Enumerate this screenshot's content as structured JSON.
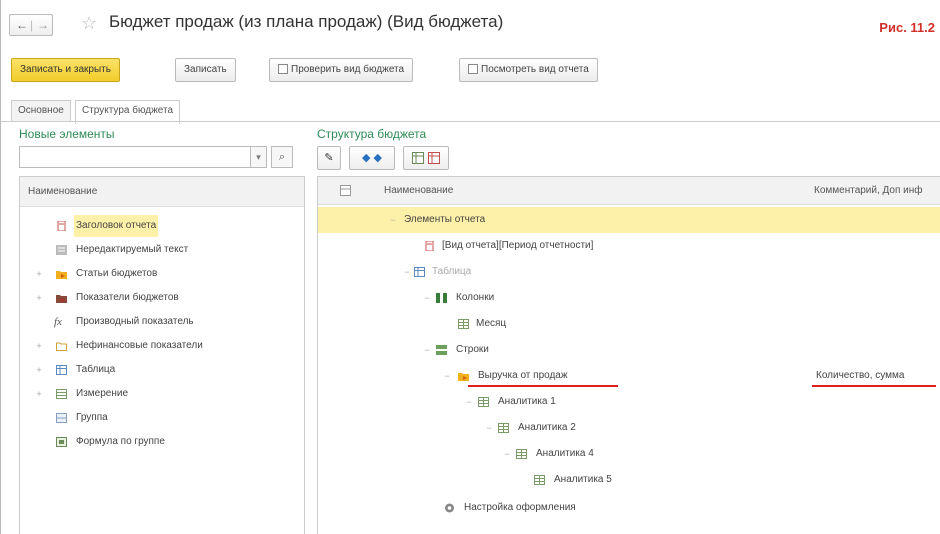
{
  "window": {
    "title": "Бюджет продаж (из плана продаж) (Вид бюджета)",
    "figure_label": "Рис. 11.2"
  },
  "toolbar": {
    "save_close": "Записать и закрыть",
    "save": "Записать",
    "check": "Проверить вид бюджета",
    "view_report": "Посмотреть вид отчета"
  },
  "tabs": [
    "Основное",
    "Структура бюджета"
  ],
  "left_panel": {
    "title": "Новые элементы",
    "search_placeholder": "",
    "column_header": "Наименование",
    "items": [
      {
        "label": "Заголовок отчета",
        "icon": "report-header-icon",
        "expandable": false,
        "selected": true
      },
      {
        "label": "Нередактируемый текст",
        "icon": "text-icon",
        "expandable": false,
        "selected": false
      },
      {
        "label": "Статьи бюджетов",
        "icon": "folder-icon",
        "expandable": true,
        "selected": false
      },
      {
        "label": "Показатели бюджетов",
        "icon": "indicator-icon",
        "expandable": true,
        "selected": false
      },
      {
        "label": "Производный показатель",
        "icon": "fx-icon",
        "expandable": false,
        "selected": false
      },
      {
        "label": "Нефинансовые показатели",
        "icon": "folder-outline-icon",
        "expandable": true,
        "selected": false
      },
      {
        "label": "Таблица",
        "icon": "table-icon",
        "expandable": true,
        "selected": false
      },
      {
        "label": "Измерение",
        "icon": "dimension-icon",
        "expandable": true,
        "selected": false
      },
      {
        "label": "Группа",
        "icon": "group-icon",
        "expandable": false,
        "selected": false
      },
      {
        "label": "Формула по группе",
        "icon": "group-formula-icon",
        "expandable": false,
        "selected": false
      }
    ]
  },
  "right_panel": {
    "title": "Структура бюджета",
    "columns": {
      "name": "Наименование",
      "comment": "Комментарий, Доп инф"
    },
    "rows": [
      {
        "label": "Элементы отчета",
        "comment": "",
        "level": 0,
        "icon": "",
        "expander": "−",
        "selected": true,
        "grey": false
      },
      {
        "label": "[Вид отчета][Период отчетности]",
        "comment": "",
        "level": 1,
        "icon": "report-header-icon",
        "expander": "",
        "selected": false,
        "grey": false
      },
      {
        "label": "Таблица",
        "comment": "",
        "level": 1,
        "icon": "table-icon",
        "expander": "−",
        "selected": false,
        "grey": true
      },
      {
        "label": "Колонки",
        "comment": "",
        "level": 2,
        "icon": "columns-icon",
        "expander": "−",
        "selected": false,
        "grey": false
      },
      {
        "label": "Месяц",
        "comment": "",
        "level": 3,
        "icon": "dimension-icon",
        "expander": "",
        "selected": false,
        "grey": false
      },
      {
        "label": "Строки",
        "comment": "",
        "level": 2,
        "icon": "rows-icon",
        "expander": "−",
        "selected": false,
        "grey": false
      },
      {
        "label": "Выручка от продаж",
        "comment": "Количество, сумма",
        "level": 3,
        "icon": "folder-icon",
        "expander": "−",
        "selected": false,
        "grey": false,
        "underline": true
      },
      {
        "label": "Аналитика 1",
        "comment": "",
        "level": 4,
        "icon": "dimension-icon",
        "expander": "−",
        "selected": false,
        "grey": false
      },
      {
        "label": "Аналитика 2",
        "comment": "",
        "level": 5,
        "icon": "dimension-icon",
        "expander": "−",
        "selected": false,
        "grey": false
      },
      {
        "label": "Аналитика 4",
        "comment": "",
        "level": 6,
        "icon": "dimension-icon",
        "expander": "−",
        "selected": false,
        "grey": false
      },
      {
        "label": "Аналитика 5",
        "comment": "",
        "level": 7,
        "icon": "dimension-icon",
        "expander": "",
        "selected": false,
        "grey": false
      },
      {
        "label": "Настройка оформления",
        "comment": "",
        "level": 1,
        "icon": "gear-icon",
        "expander": "",
        "selected": false,
        "grey": false
      }
    ]
  },
  "colors": {
    "accent_green": "#2e8b57",
    "selection": "#fdf0a8",
    "primary_button": "#f2cd2a",
    "annotation_red": "#e02020"
  }
}
